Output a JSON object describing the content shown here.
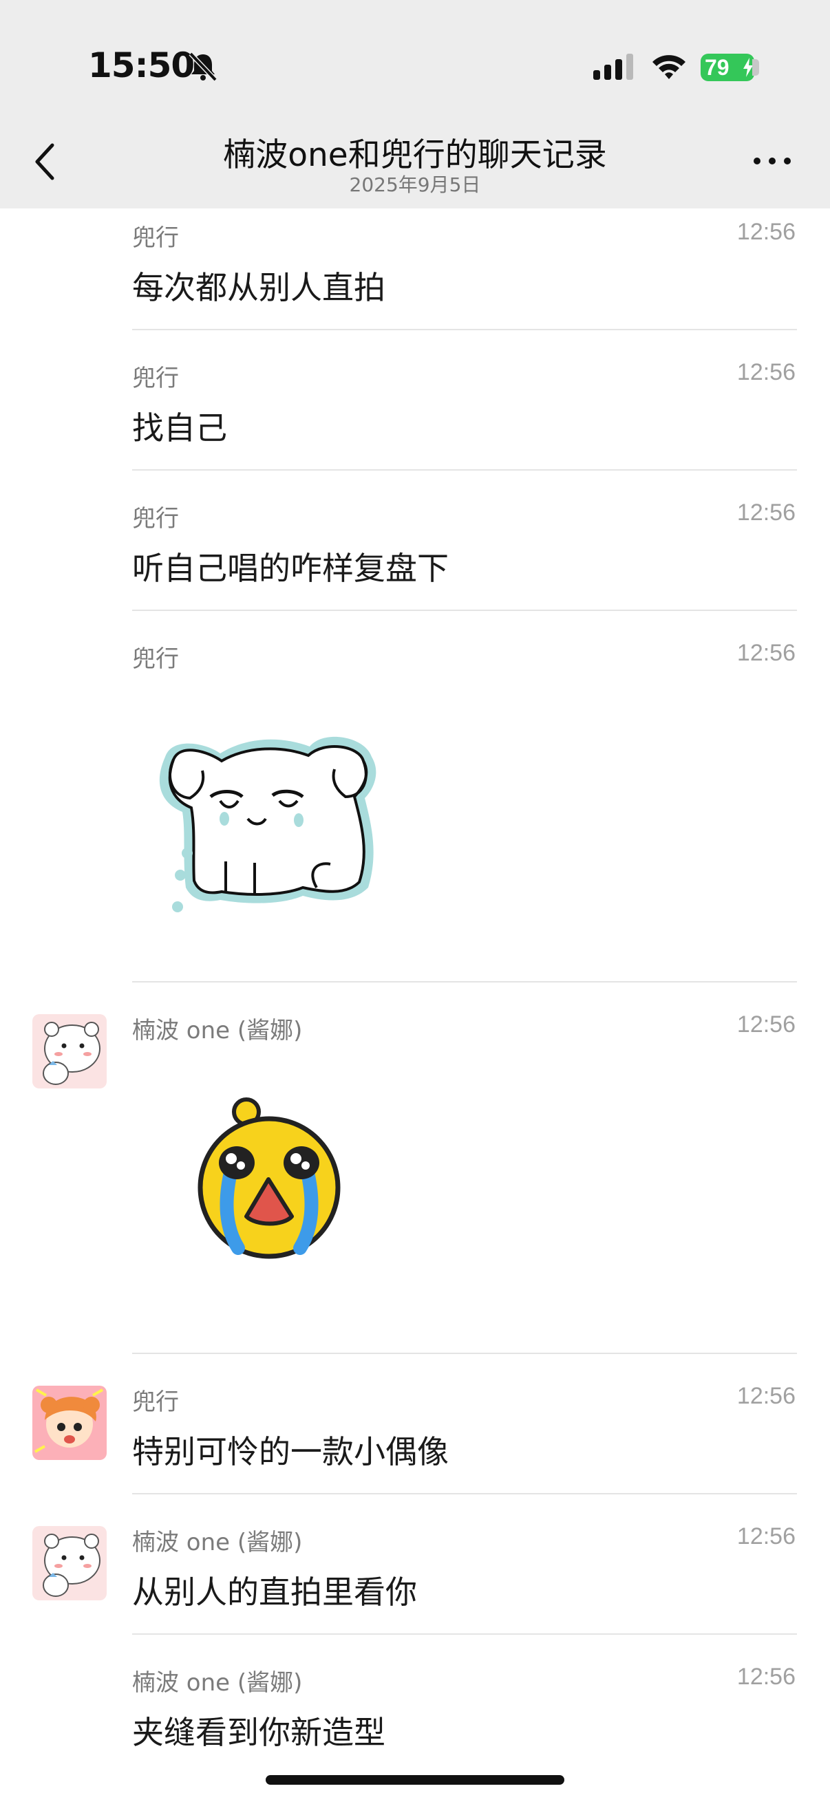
{
  "status_bar": {
    "time": "15:50",
    "battery": "79"
  },
  "nav": {
    "title": "楠波one和兜行的聊天记录",
    "subtitle": "2025年9月5日"
  },
  "messages": [
    {
      "sender": "兜行",
      "time": "12:56",
      "text": "每次都从别人直拍"
    },
    {
      "sender": "兜行",
      "time": "12:56",
      "text": "找自己"
    },
    {
      "sender": "兜行",
      "time": "12:56",
      "text": "听自己唱的咋样复盘下"
    },
    {
      "sender": "兜行",
      "time": "12:56",
      "sticker": "crying-dog-sticker"
    },
    {
      "sender": "楠波 one (酱娜)",
      "time": "12:56",
      "sticker": "crying-face-sticker"
    },
    {
      "sender": "兜行",
      "time": "12:56",
      "text": "特别可怜的一款小偶像"
    },
    {
      "sender": "楠波 one (酱娜)",
      "time": "12:56",
      "text": "从别人的直拍里看你"
    },
    {
      "sender": "楠波 one (酱娜)",
      "time": "12:56",
      "text": "夹缝看到你新造型"
    }
  ],
  "colors": {
    "header_bg": "#ededed",
    "battery": "#34c759",
    "sticker_outline": "#a9dcdc",
    "emoji_yellow": "#f7d21c",
    "tear_blue": "#3d9be9"
  }
}
